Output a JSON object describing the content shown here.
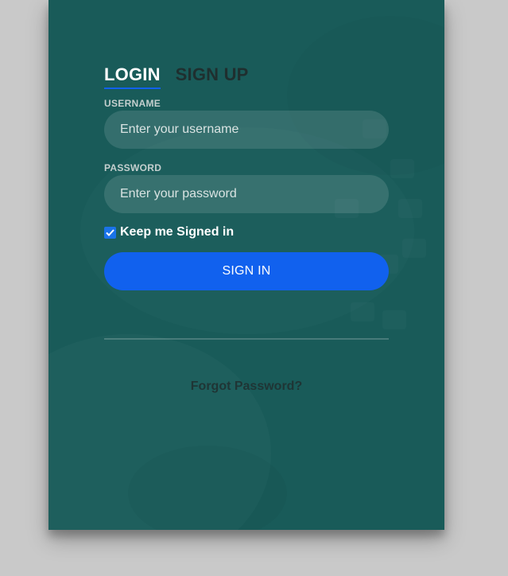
{
  "tabs": {
    "login": "LOGIN",
    "signup": "SIGN UP"
  },
  "username": {
    "label": "USERNAME",
    "placeholder": "Enter your username",
    "value": ""
  },
  "password": {
    "label": "PASSWORD",
    "placeholder": "Enter your password",
    "value": ""
  },
  "remember": {
    "label": "Keep me Signed in",
    "checked": true
  },
  "signin_button": "SIGN IN",
  "forgot_link": "Forgot Password?",
  "colors": {
    "accent": "#1161ee",
    "card_bg": "#1d5e5c",
    "page_bg": "#c9c9c9"
  }
}
